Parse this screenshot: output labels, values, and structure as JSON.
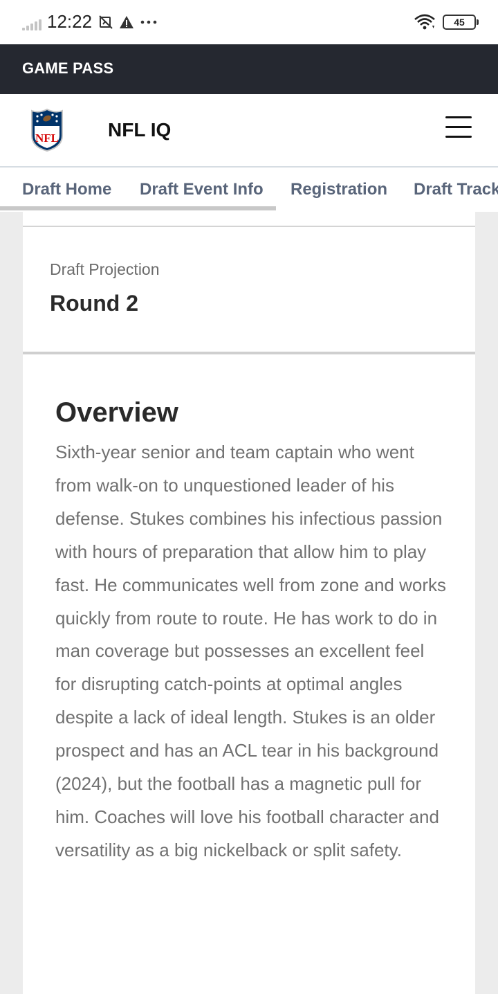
{
  "status_bar": {
    "time": "12:22",
    "battery_level": "45",
    "icons": [
      "signal-icon",
      "screenshot-icon",
      "warning-icon",
      "more-dots-icon",
      "wifi-icon",
      "battery-icon"
    ]
  },
  "top_bar": {
    "label": "GAME PASS"
  },
  "header": {
    "site_title": "NFL IQ",
    "logo_text": "NFL"
  },
  "tabs": [
    {
      "label": "Draft Home"
    },
    {
      "label": "Draft Event Info"
    },
    {
      "label": "Registration"
    },
    {
      "label": "Draft Track"
    }
  ],
  "projection": {
    "label": "Draft Projection",
    "value": "Round 2"
  },
  "overview": {
    "title": "Overview",
    "text": "Sixth-year senior and team captain who went from walk-on to unquestioned leader of his defense. Stukes combines his infectious passion with hours of preparation that allow him to play fast. He communicates well from zone and works quickly from route to route. He has work to do in man coverage but possesses an excellent feel for disrupting catch-points at optimal angles despite a lack of ideal length. Stukes is an older prospect and has an ACL tear in his background (2024), but the football has a magnetic pull for him. Coaches will love his football character and versatility as a big nickelback or split safety."
  },
  "colors": {
    "top_bar_bg": "#252830",
    "tab_text": "#59657a",
    "nfl_blue": "#013369",
    "nfl_red": "#d50a0a",
    "body_text": "#717171"
  }
}
